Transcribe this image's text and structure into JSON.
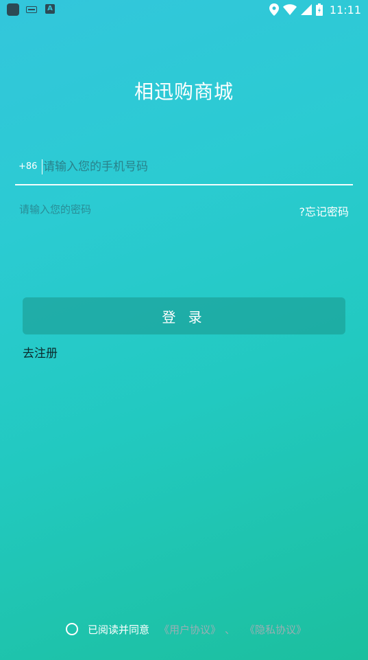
{
  "status_bar": {
    "time": "11:11",
    "left_icons": [
      "app-icon",
      "keyboard-icon",
      "a-icon"
    ],
    "right_icons": [
      "location-icon",
      "wifi-icon",
      "signal-icon",
      "battery-icon"
    ]
  },
  "app": {
    "title": "相迅购商城"
  },
  "login_form": {
    "country_code": "+86",
    "phone_placeholder": "请输入您的手机号码",
    "password_placeholder": "请输入您的密码",
    "forgot_password": "?忘记密码",
    "login_button": "登 录",
    "register_link": "去注册"
  },
  "agreement": {
    "text": "已阅读并同意",
    "user_agreement": "《用户协议》",
    "separator": "、",
    "privacy_policy": "《隐私协议》",
    "checked": false
  },
  "colors": {
    "gradient_top": "#33c6dc",
    "gradient_bottom": "#1cbf9e",
    "button_bg": "#23a59b",
    "text_primary": "#ffffff"
  }
}
